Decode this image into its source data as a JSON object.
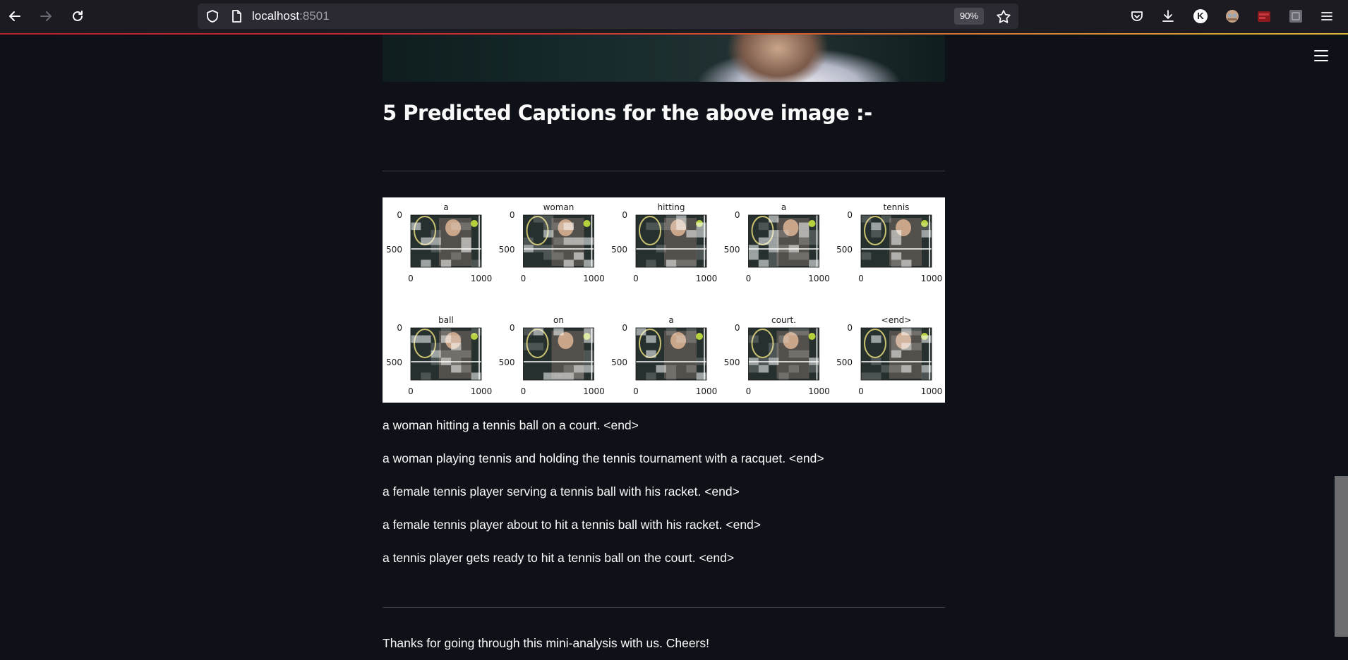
{
  "browser": {
    "url_host": "localhost",
    "url_port": ":8501",
    "zoom": "90%",
    "profile_initial": "K",
    "icons": [
      "back-icon",
      "forward-icon",
      "reload-icon",
      "shield-icon",
      "page-icon",
      "star-icon",
      "pocket-icon",
      "download-icon",
      "avatar-icon",
      "extension-icon",
      "extension-icon",
      "extension-icon",
      "menu-icon"
    ]
  },
  "page": {
    "heading": "5 Predicted Captions for the above image :-",
    "captions": [
      "a woman hitting a tennis ball on a court. <end>",
      "a woman playing tennis and holding the tennis tournament with a racquet. <end>",
      "a female tennis player serving a tennis ball with his racket. <end>",
      "a female tennis player about to hit a tennis ball with his racket. <end>",
      "a tennis player gets ready to hit a tennis ball on the court. <end>"
    ],
    "footer": "Thanks for going through this mini-analysis with us. Cheers!"
  },
  "attention_figure": {
    "words": [
      "a",
      "woman",
      "hitting",
      "a",
      "tennis",
      "ball",
      "on",
      "a",
      "court.",
      "<end>"
    ],
    "y_ticks": [
      "0",
      "500"
    ],
    "x_ticks": [
      "0",
      "1000"
    ],
    "colors": {
      "background": "#0e1117",
      "text": "#fafafa",
      "divider": "#3a3d44",
      "figure_bg": "#ffffff"
    }
  }
}
